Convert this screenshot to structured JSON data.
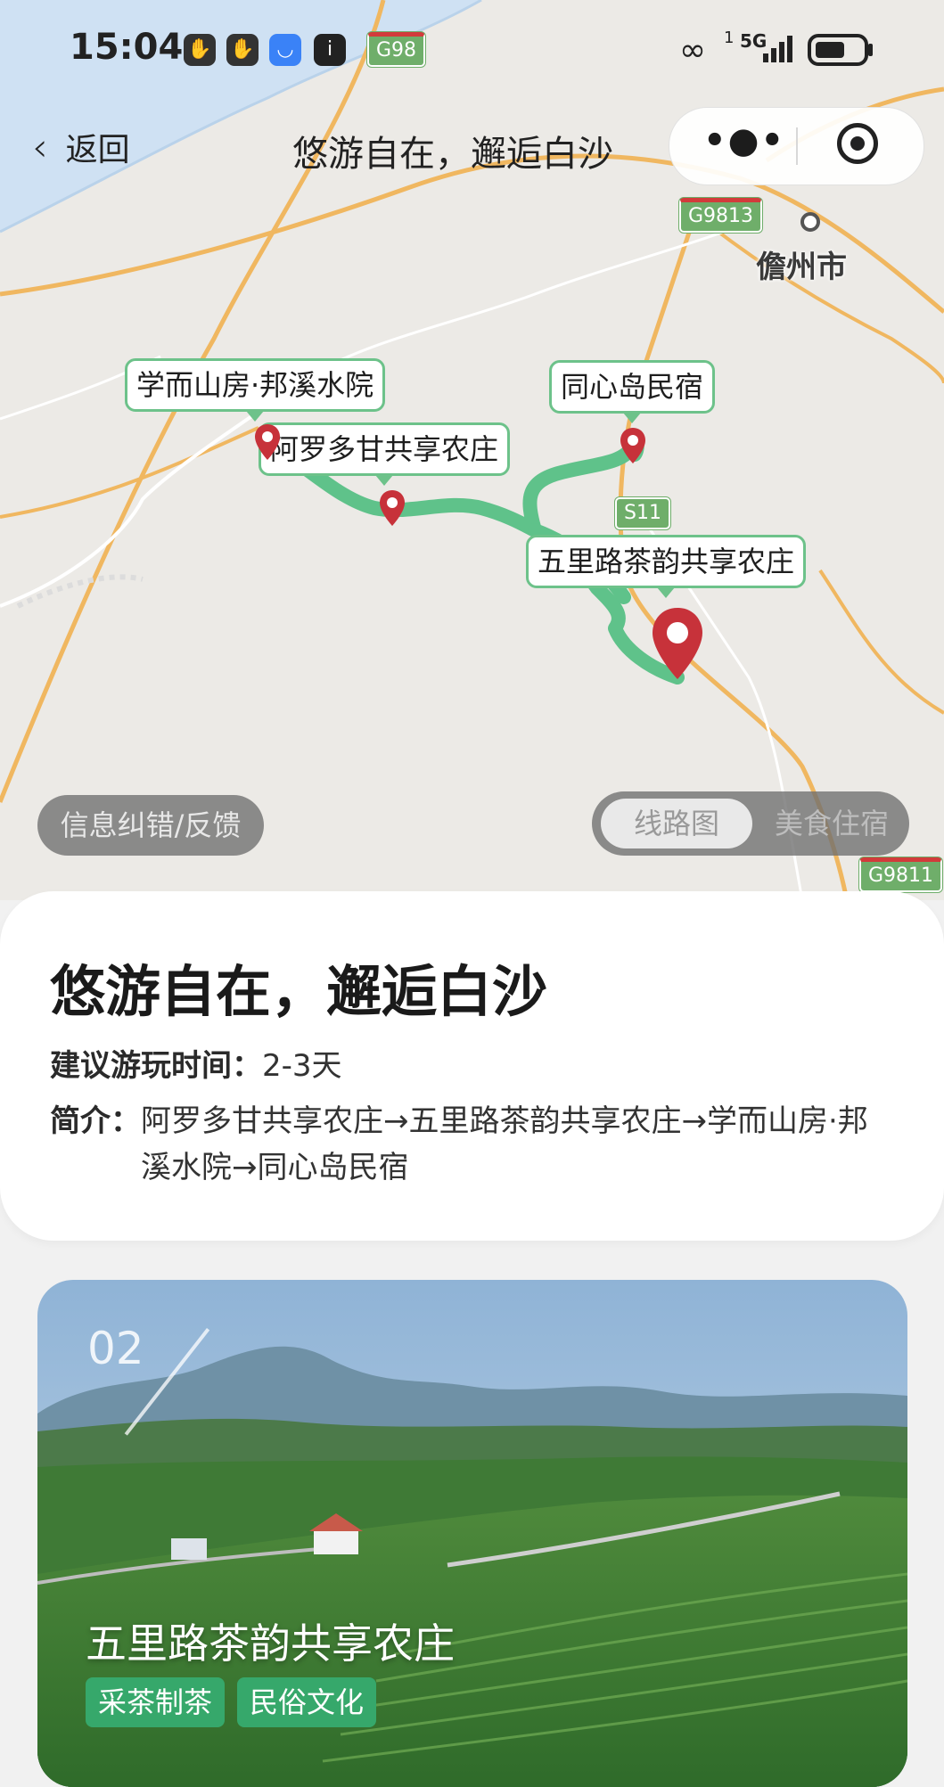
{
  "status_bar": {
    "time": "15:04",
    "network": "5G",
    "sim_index": "1"
  },
  "nav": {
    "back_label": "返回",
    "title": "悠游自在，邂逅白沙"
  },
  "map": {
    "roads": [
      "G98",
      "G9813",
      "S11",
      "G9811"
    ],
    "city": "儋州市",
    "pois": [
      {
        "name": "学而山房·邦溪水院"
      },
      {
        "name": "同心岛民宿"
      },
      {
        "name": "阿罗多甘共享农庄"
      },
      {
        "name": "五里路茶韵共享农庄"
      }
    ],
    "feedback_label": "信息纠错/反馈",
    "toggle": {
      "active": "线路图",
      "inactive": "美食住宿"
    }
  },
  "route": {
    "title": "悠游自在，邂逅白沙",
    "duration_key": "建议游玩时间：",
    "duration_value": "2-3天",
    "intro_key": "简介：",
    "intro_value": "阿罗多甘共享农庄→五里路茶韵共享农庄→学而山房·邦溪水院→同心岛民宿"
  },
  "attraction": {
    "index": "02",
    "name": "五里路茶韵共享农庄",
    "tags": [
      "采茶制茶",
      "民俗文化"
    ]
  },
  "colors": {
    "route_green": "#5fc28a",
    "pin_red": "#c7323a",
    "tag_green": "#36a86b"
  }
}
